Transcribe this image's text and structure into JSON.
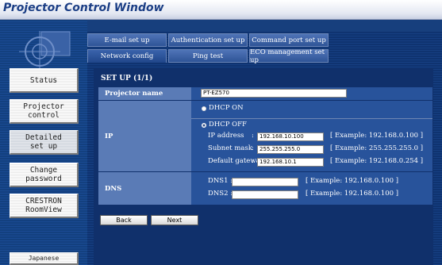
{
  "window": {
    "title": "Projector Control Window"
  },
  "sidebar": {
    "buttons": [
      {
        "label": "Status"
      },
      {
        "label": "Projector\ncontrol"
      },
      {
        "label": "Detailed\nset up"
      },
      {
        "label": "Change\npassword"
      },
      {
        "label": "CRESTRON\nRoomView"
      },
      {
        "label": "Japanese"
      }
    ]
  },
  "tabs": {
    "row1": [
      "E-mail set up",
      "Authentication set up",
      "Command port set up"
    ],
    "row2": [
      "Network config",
      "Ping test",
      "ECO management set up"
    ],
    "active": "Network config"
  },
  "setup": {
    "heading": "SET UP (1/1)"
  },
  "form": {
    "projector_name": {
      "label": "Projector name",
      "value": "PT-EZ570"
    },
    "ip": {
      "label": "IP",
      "dhcp_on": "DHCP ON",
      "dhcp_off": "DHCP OFF",
      "selected": "DHCP ON",
      "fields": [
        {
          "label": "IP address",
          "value": "192.168.10.100",
          "example": "[ Example: 192.168.0.100 ]"
        },
        {
          "label": "Subnet mask",
          "value": "255.255.255.0",
          "example": "[ Example: 255.255.255.0 ]"
        },
        {
          "label": "Default gateway",
          "value": "192.168.10.1",
          "example": "[ Example: 192.168.0.254 ]"
        }
      ]
    },
    "dns": {
      "label": "DNS",
      "fields": [
        {
          "label": "DNS1 :",
          "value": "",
          "example": "[ Example: 192.168.0.100 ]"
        },
        {
          "label": "DNS2 :",
          "value": "",
          "example": "[ Example: 192.168.0.100 ]"
        }
      ]
    }
  },
  "buttons": {
    "back": "Back",
    "next": "Next"
  }
}
